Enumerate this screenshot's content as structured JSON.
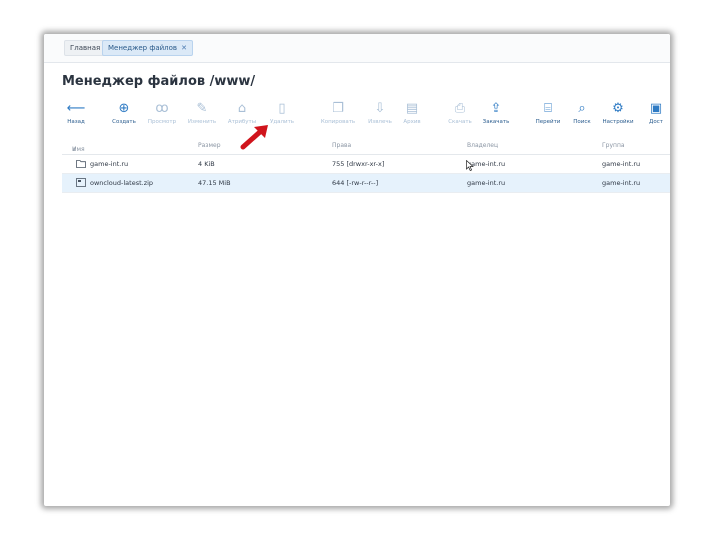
{
  "tabs": [
    {
      "label": "Главная"
    },
    {
      "label": "Менеджер файлов",
      "close": "✕"
    }
  ],
  "page_title": "Менеджер файлов /www/",
  "toolbar": [
    {
      "label": "Назад",
      "icon": "arrow-left-icon",
      "enabled": true
    },
    {
      "label": "Создать",
      "icon": "plus-circle-icon",
      "enabled": true
    },
    {
      "label": "Просмотр",
      "icon": "glasses-icon",
      "enabled": false
    },
    {
      "label": "Изменить",
      "icon": "pencil-icon",
      "enabled": false
    },
    {
      "label": "Атрибуты",
      "icon": "tag-icon",
      "enabled": false
    },
    {
      "label": "Удалить",
      "icon": "trash-icon",
      "enabled": false
    },
    {
      "label": "Копировать",
      "icon": "copy-icon",
      "enabled": false
    },
    {
      "label": "Извлечь",
      "icon": "extract-icon",
      "enabled": false
    },
    {
      "label": "Архив",
      "icon": "archive-icon",
      "enabled": false
    },
    {
      "label": "Скачать",
      "icon": "download-icon",
      "enabled": false
    },
    {
      "label": "Закачать",
      "icon": "upload-icon",
      "enabled": true
    },
    {
      "label": "Перейти",
      "icon": "folder-open-icon",
      "enabled": true
    },
    {
      "label": "Поиск",
      "icon": "search-icon",
      "enabled": true
    },
    {
      "label": "Настройки",
      "icon": "gear-icon",
      "enabled": true
    },
    {
      "label": "Дост",
      "icon": "lock-icon",
      "enabled": true
    }
  ],
  "table": {
    "columns": [
      "Имя",
      "Размер",
      "Права",
      "Владелец",
      "Группа"
    ],
    "sort_indicator": "∨",
    "rows": [
      {
        "type": "folder",
        "name": "game-int.ru",
        "size": "4 KiB",
        "perms": "755 [drwxr-xr-x]",
        "owner": "game-int.ru",
        "group": "game-int.ru",
        "selected": false
      },
      {
        "type": "file",
        "name": "owncloud-latest.zip",
        "size": "47.15 MiB",
        "perms": "644 [-rw-r--r--]",
        "owner": "game-int.ru",
        "group": "game-int.ru",
        "selected": true
      }
    ]
  },
  "colors": {
    "accent": "#2f7bc4",
    "disabled": "#a9bfd6",
    "selected_row": "#e6f2fc",
    "annotation_arrow": "#d0141c"
  }
}
